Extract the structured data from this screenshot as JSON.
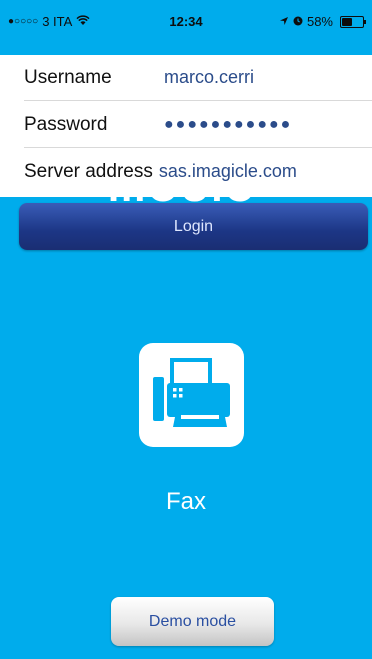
{
  "status_bar": {
    "signal": "●○○○○",
    "carrier": "3 ITA",
    "time": "12:34",
    "battery_percent": "58%",
    "battery_level": 0.58
  },
  "form": {
    "username_label": "Username",
    "username_value": "marco.cerri",
    "password_label": "Password",
    "password_value": "●●●●●●●●●●●",
    "server_label": "Server address",
    "server_value": "sas.imagicle.com"
  },
  "login_label": "Login",
  "app": {
    "tile_icon": "fax-machine-icon",
    "name": "Fax"
  },
  "demo_label": "Demo mode",
  "colors": {
    "background": "#00acec",
    "login_button": "#1c3685",
    "value_text": "#2b4c8a"
  }
}
